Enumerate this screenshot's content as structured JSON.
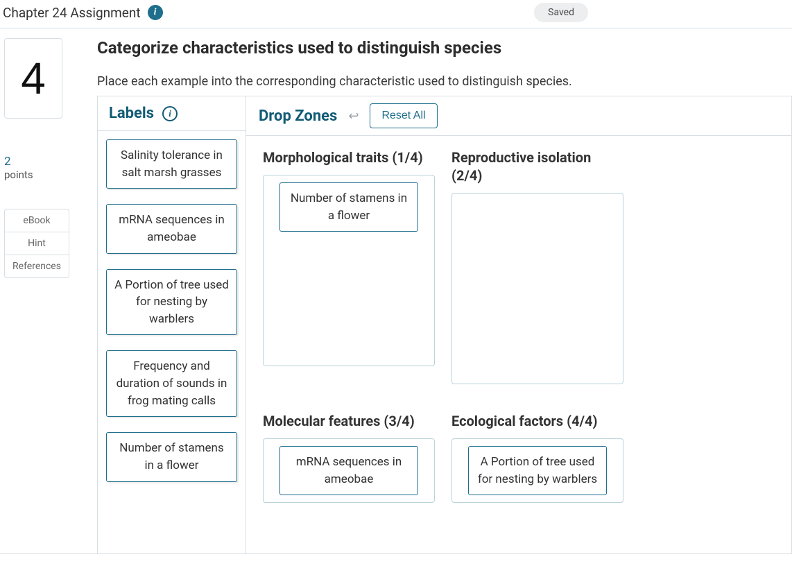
{
  "header": {
    "title": "Chapter 24 Assignment",
    "saved_label": "Saved"
  },
  "sidebar": {
    "question_number": "4",
    "points_value": "2",
    "points_label": "points",
    "links": [
      "eBook",
      "Hint",
      "References"
    ]
  },
  "question": {
    "title": "Categorize characteristics used to distinguish species",
    "instructions": "Place each example into the corresponding characteristic used to distinguish species."
  },
  "labels_header": "Labels",
  "dropzones_header": "Drop Zones",
  "reset_label": "Reset All",
  "labels": [
    "Salinity tolerance in salt marsh grasses",
    "mRNA sequences in ameobae",
    "A Portion of tree used for nesting by warblers",
    "Frequency and duration of sounds in frog mating calls",
    "Number of stamens in a flower"
  ],
  "zones": [
    {
      "title": "Morphological traits (1/4)",
      "tall": true,
      "items": [
        "Number of stamens in a flower"
      ]
    },
    {
      "title": "Reproductive isolation (2/4)",
      "tall": true,
      "items": []
    },
    {
      "title": "Molecular features (3/4)",
      "tall": false,
      "items": [
        "mRNA sequences in ameobae"
      ]
    },
    {
      "title": "Ecological factors (4/4)",
      "tall": false,
      "items": [
        "A Portion of tree used for nesting by warblers"
      ]
    }
  ]
}
